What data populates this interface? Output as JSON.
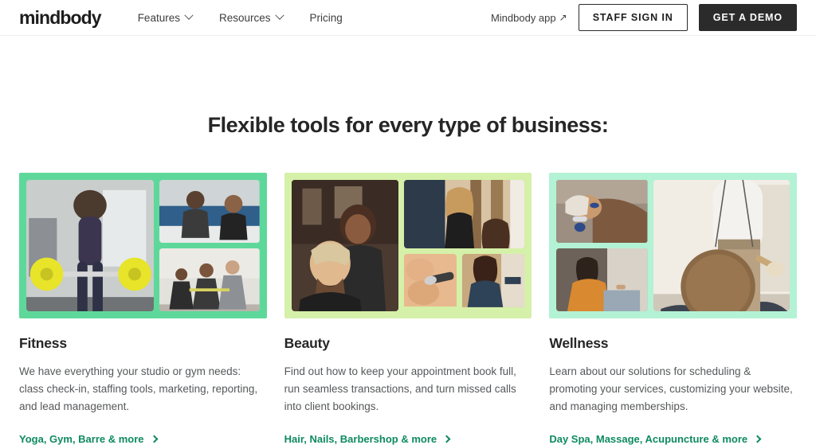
{
  "header": {
    "logo": "mindbody",
    "nav": [
      {
        "label": "Features",
        "icon": "chevron-down-icon",
        "has_chevron": true
      },
      {
        "label": "Resources",
        "icon": "chevron-down-icon",
        "has_chevron": true
      },
      {
        "label": "Pricing",
        "has_chevron": false
      }
    ],
    "app_link": {
      "label": "Mindbody app",
      "icon": "arrow-up-right-icon",
      "glyph": "↗"
    },
    "staff_sign_in": "STAFF SIGN IN",
    "get_a_demo": "GET A DEMO"
  },
  "main": {
    "headline": "Flexible tools for every type of business:",
    "cards": [
      {
        "title": "Fitness",
        "body": "We have everything your studio or gym needs: class check-in, staffing tools, marketing, reporting, and lead management.",
        "link": "Yoga, Gym, Barre & more",
        "link_icon": "chevron-right-icon",
        "bg_color": "#5ed89a",
        "layout": "layout-a"
      },
      {
        "title": "Beauty",
        "body": "Find out how to keep your appointment book full, run seamless transactions, and turn missed calls into client bookings.",
        "link": "Hair, Nails, Barbershop & more",
        "link_icon": "chevron-right-icon",
        "bg_color": "#d5f0a8",
        "layout": "layout-b"
      },
      {
        "title": "Wellness",
        "body": "Learn about our solutions for scheduling & promoting your services, customizing your website, and managing memberships.",
        "link": "Day Spa, Massage, Acupuncture & more",
        "link_icon": "chevron-right-icon",
        "bg_color": "#b3f2d4",
        "layout": "layout-c"
      }
    ]
  },
  "colors": {
    "link_green": "#0e8a5f",
    "text_dark": "#262626",
    "text_body": "#56585a",
    "button_dark": "#2b2b2b"
  }
}
